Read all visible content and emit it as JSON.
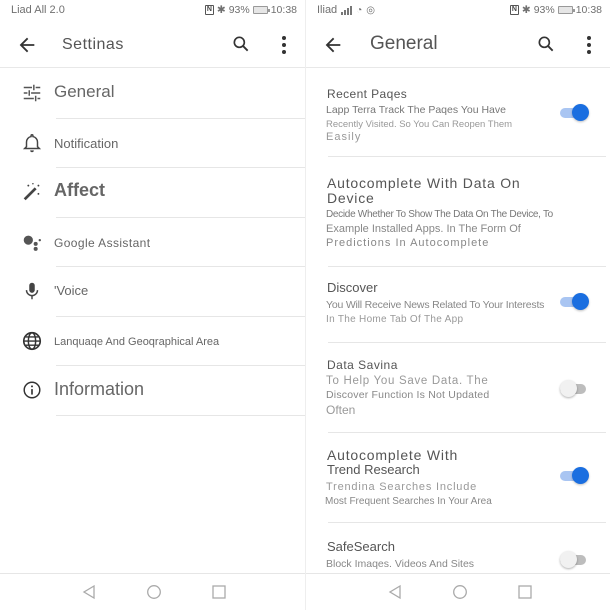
{
  "left_screen": {
    "status_bar": {
      "carrier": "Liad All 2.0",
      "battery_percent": "93%",
      "time": "10:38"
    },
    "app_bar": {
      "title": "Settinas",
      "back_icon": "arrow-back-icon",
      "search_icon": "search-icon",
      "more_icon": "more-vert-icon"
    },
    "settings": [
      {
        "label": "General",
        "icon": "tune-sliders-icon"
      },
      {
        "label": "Notification",
        "icon": "bell-icon"
      },
      {
        "label": "Affect",
        "icon": "magic-wand-icon"
      },
      {
        "label": "Google Assistant",
        "icon": "google-assistant-icon"
      },
      {
        "label": "'Voice",
        "icon": "microphone-icon"
      },
      {
        "label": "Lanquaqe And Geoqraphical Area",
        "icon": "globe-icon"
      },
      {
        "label": "Information",
        "icon": "info-icon"
      }
    ]
  },
  "right_screen": {
    "status_bar": {
      "carrier": "Iliad",
      "battery_percent": "93%",
      "time": "10:38"
    },
    "app_bar": {
      "title": "General",
      "back_icon": "arrow-back-icon",
      "search_icon": "search-icon",
      "more_icon": "more-vert-icon"
    },
    "options": [
      {
        "title": "Recent Paqes",
        "description": [
          "Lapp Terra Track The Paqes You Have",
          "Recently Visited. So You Can Reopen Them",
          "Easily"
        ],
        "toggle": true
      },
      {
        "title": "Autocomplete With Data On",
        "title2": "Device",
        "description": [
          "Decide Whether To Show The Data On The Device, To",
          "Example Installed Apps. In The Form Of",
          "Predictions In Autocomplete"
        ],
        "toggle": null
      },
      {
        "title": "Discover",
        "description": [
          "You Will Receive News Related To Your Interests",
          "In The Home Tab Of The App"
        ],
        "toggle": true
      },
      {
        "title": "Data Savina",
        "description": [
          "To Help You Save Data. The",
          "Discover Function Is Not Updated",
          "Often"
        ],
        "toggle": false
      },
      {
        "title": "Autocomplete With",
        "title2": "Trend Research",
        "description": [
          "Trendina Searches Include",
          "Most Frequent Searches In Your Area"
        ],
        "toggle": true
      },
      {
        "title": "SafeSearch",
        "description": [
          "Block Imaqes. Videos And Sites"
        ],
        "toggle": false
      }
    ]
  },
  "nav_bar": {
    "back": "nav-back-icon",
    "home": "nav-home-icon",
    "recents": "nav-recents-icon"
  },
  "colors": {
    "accent": "#1a6ee0",
    "accent_track": "#a9c5f2",
    "off_track": "#bdbdbd",
    "text_primary": "#555555",
    "text_secondary": "#888888",
    "divider": "#e6e6e6"
  }
}
